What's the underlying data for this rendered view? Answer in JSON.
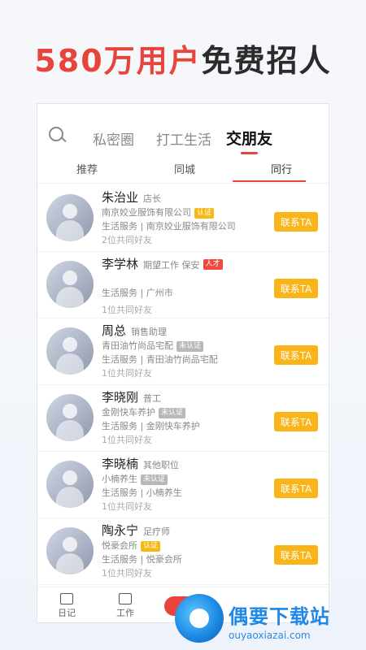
{
  "headline": {
    "part1": "580万用户",
    "part2": "免费招人"
  },
  "top_tabs": [
    "私密圈",
    "打工生活",
    "交朋友"
  ],
  "sub_tabs": [
    "推荐",
    "同城",
    "同行"
  ],
  "people": [
    {
      "name": "朱治业",
      "role": "店长",
      "tag": "认证",
      "tag_style": "yellow",
      "line1": "南京姣业服饰有限公司",
      "line2": "生活服务 | 南京姣业服饰有限公司",
      "line3": "2位共同好友",
      "button": "联系TA"
    },
    {
      "name": "李学林",
      "role": "期望工作 保安",
      "tag": "人才",
      "tag_style": "red",
      "line1": "",
      "line2": "生活服务 | 广州市",
      "line3": "1位共同好友",
      "button": "联系TA"
    },
    {
      "name": "周总",
      "role": "销售助理",
      "tag": "未认证",
      "tag_style": "gray",
      "line1": "青田油竹尚品宅配",
      "line2": "生活服务 | 青田油竹尚品宅配",
      "line3": "1位共同好友",
      "button": "联系TA"
    },
    {
      "name": "李晓刚",
      "role": "普工",
      "tag": "未认证",
      "tag_style": "gray",
      "line1": "金刚快车养护",
      "line2": "生活服务 | 金刚快车养护",
      "line3": "1位共同好友",
      "button": "联系TA"
    },
    {
      "name": "李晓楠",
      "role": "其他职位",
      "tag": "未认证",
      "tag_style": "gray",
      "line1": "小楠养生",
      "line2": "生活服务 | 小楠养生",
      "line3": "1位共同好友",
      "button": "联系TA"
    },
    {
      "name": "陶永宁",
      "role": "足疗师",
      "tag": "认证",
      "tag_style": "yellow",
      "line1": "悦豪会所",
      "line2": "生活服务 | 悦豪会所",
      "line3": "1位共同好友",
      "button": "联系TA"
    }
  ],
  "bottom_nav": [
    "日记",
    "工作"
  ],
  "watermark": {
    "title": "偶要下载站",
    "url": "ouyaoxiazai.com"
  },
  "colors": {
    "accent": "#e8443b",
    "button": "#f8b418"
  }
}
